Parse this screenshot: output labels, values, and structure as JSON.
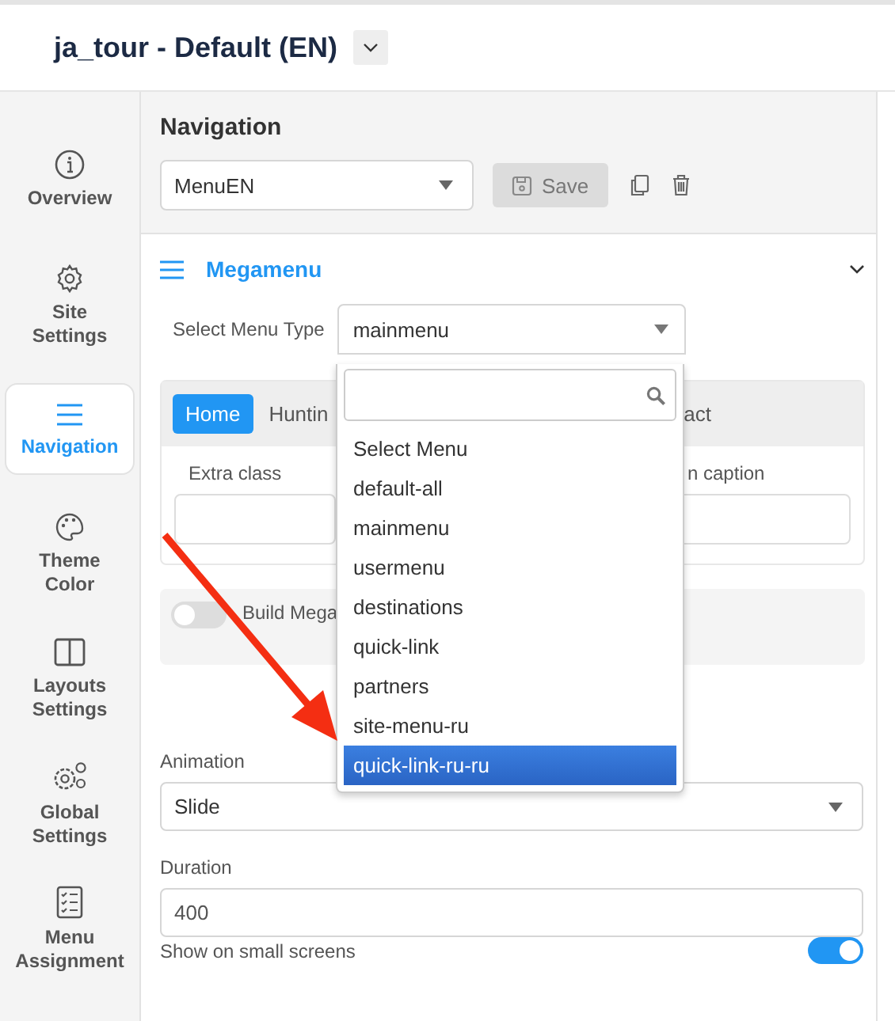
{
  "header": {
    "title": "ja_tour - Default (EN)"
  },
  "sidebar": {
    "items": [
      {
        "label": "Overview",
        "selected": false
      },
      {
        "label": "Site Settings",
        "selected": false
      },
      {
        "label": "Navigation",
        "selected": true
      },
      {
        "label": "Theme Color",
        "selected": false
      },
      {
        "label": "Layouts Settings",
        "selected": false
      },
      {
        "label": "Global Settings",
        "selected": false
      },
      {
        "label": "Menu Assignment",
        "selected": false
      }
    ]
  },
  "navigation": {
    "title": "Navigation",
    "menu_select": {
      "value": "MenuEN"
    },
    "save_button": "Save"
  },
  "megamenu": {
    "title": "Megamenu",
    "menu_type": {
      "label": "Select Menu Type",
      "value": "mainmenu"
    },
    "tabs": [
      {
        "label": "Home",
        "selected": true
      },
      {
        "label": "Huntin",
        "selected": false
      }
    ],
    "tab_cut": "act",
    "fields": [
      {
        "label": "Extra class"
      },
      {
        "label": "n caption"
      }
    ],
    "build_toggle": {
      "label": "Build Mega",
      "on": false
    },
    "animation": {
      "label": "Animation",
      "value": "Slide"
    },
    "duration": {
      "label": "Duration",
      "value": "400"
    },
    "small_screens": {
      "label": "Show on small screens",
      "on": true
    }
  },
  "dropdown": {
    "items": [
      {
        "label": "Select Menu",
        "selected": false
      },
      {
        "label": "default-all",
        "selected": false
      },
      {
        "label": "mainmenu",
        "selected": false
      },
      {
        "label": "usermenu",
        "selected": false
      },
      {
        "label": "destinations",
        "selected": false
      },
      {
        "label": "quick-link",
        "selected": false
      },
      {
        "label": "partners",
        "selected": false
      },
      {
        "label": "site-menu-ru",
        "selected": false
      },
      {
        "label": "quick-link-ru-ru",
        "selected": true
      }
    ]
  }
}
